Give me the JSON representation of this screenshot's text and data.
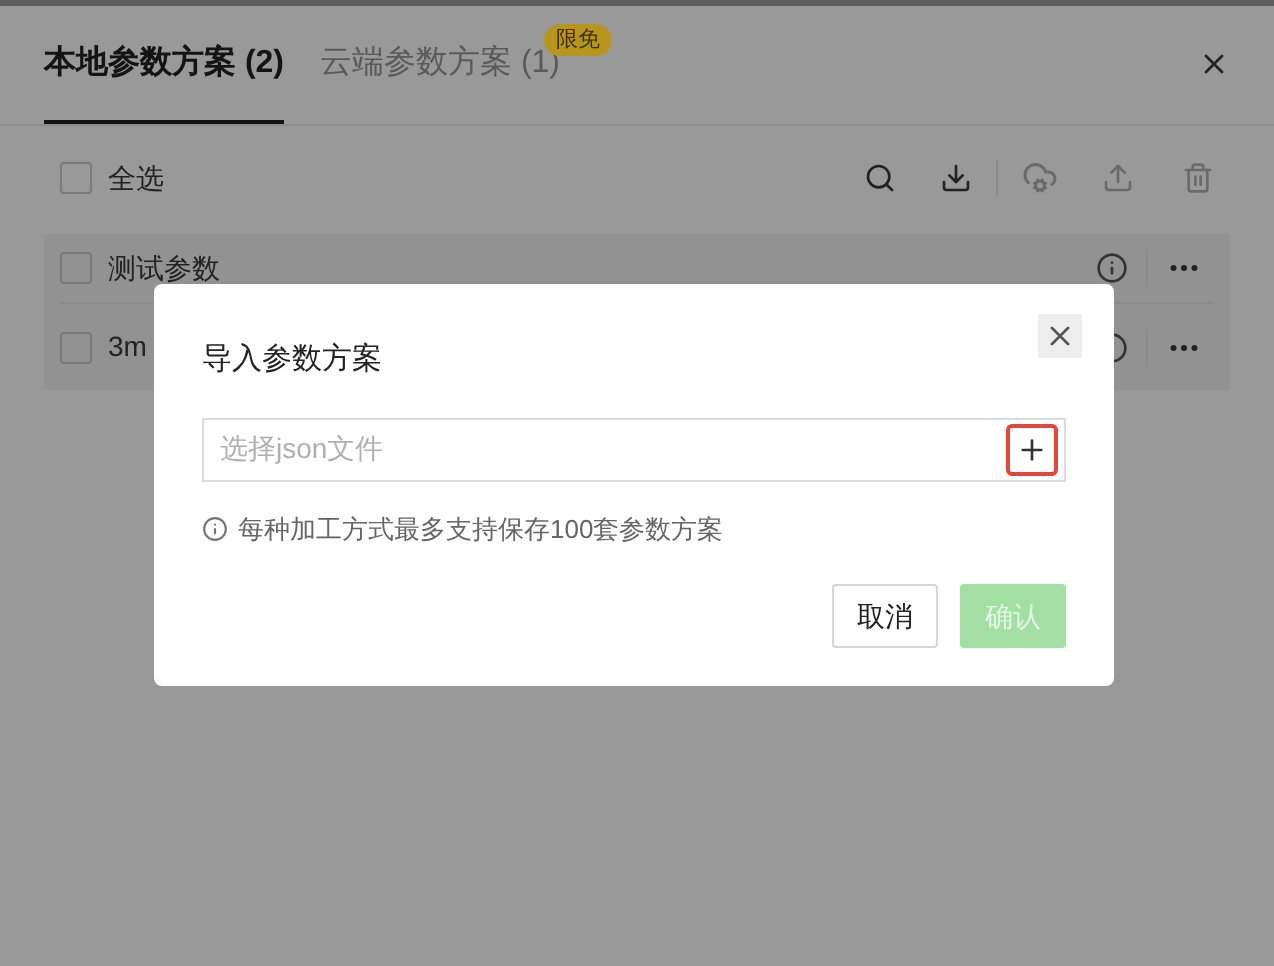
{
  "tabs": [
    {
      "label": "本地参数方案 (2)",
      "selected": true
    },
    {
      "label": "云端参数方案 (1)",
      "selected": false,
      "badge": "限免"
    }
  ],
  "toolbar": {
    "select_all": {
      "label": "全选",
      "checked": false
    }
  },
  "schemes": [
    {
      "name": "测试参数",
      "checked": false
    },
    {
      "name": "3m",
      "checked": false
    }
  ],
  "dialog": {
    "title": "导入参数方案",
    "file_field": {
      "placeholder": "选择json文件"
    },
    "note": "每种加工方式最多支持保存100套参数方案",
    "buttons": [
      {
        "label": "取消",
        "kind": "cancel",
        "disabled": false
      },
      {
        "label": "确认",
        "kind": "confirm",
        "disabled": true
      }
    ]
  }
}
